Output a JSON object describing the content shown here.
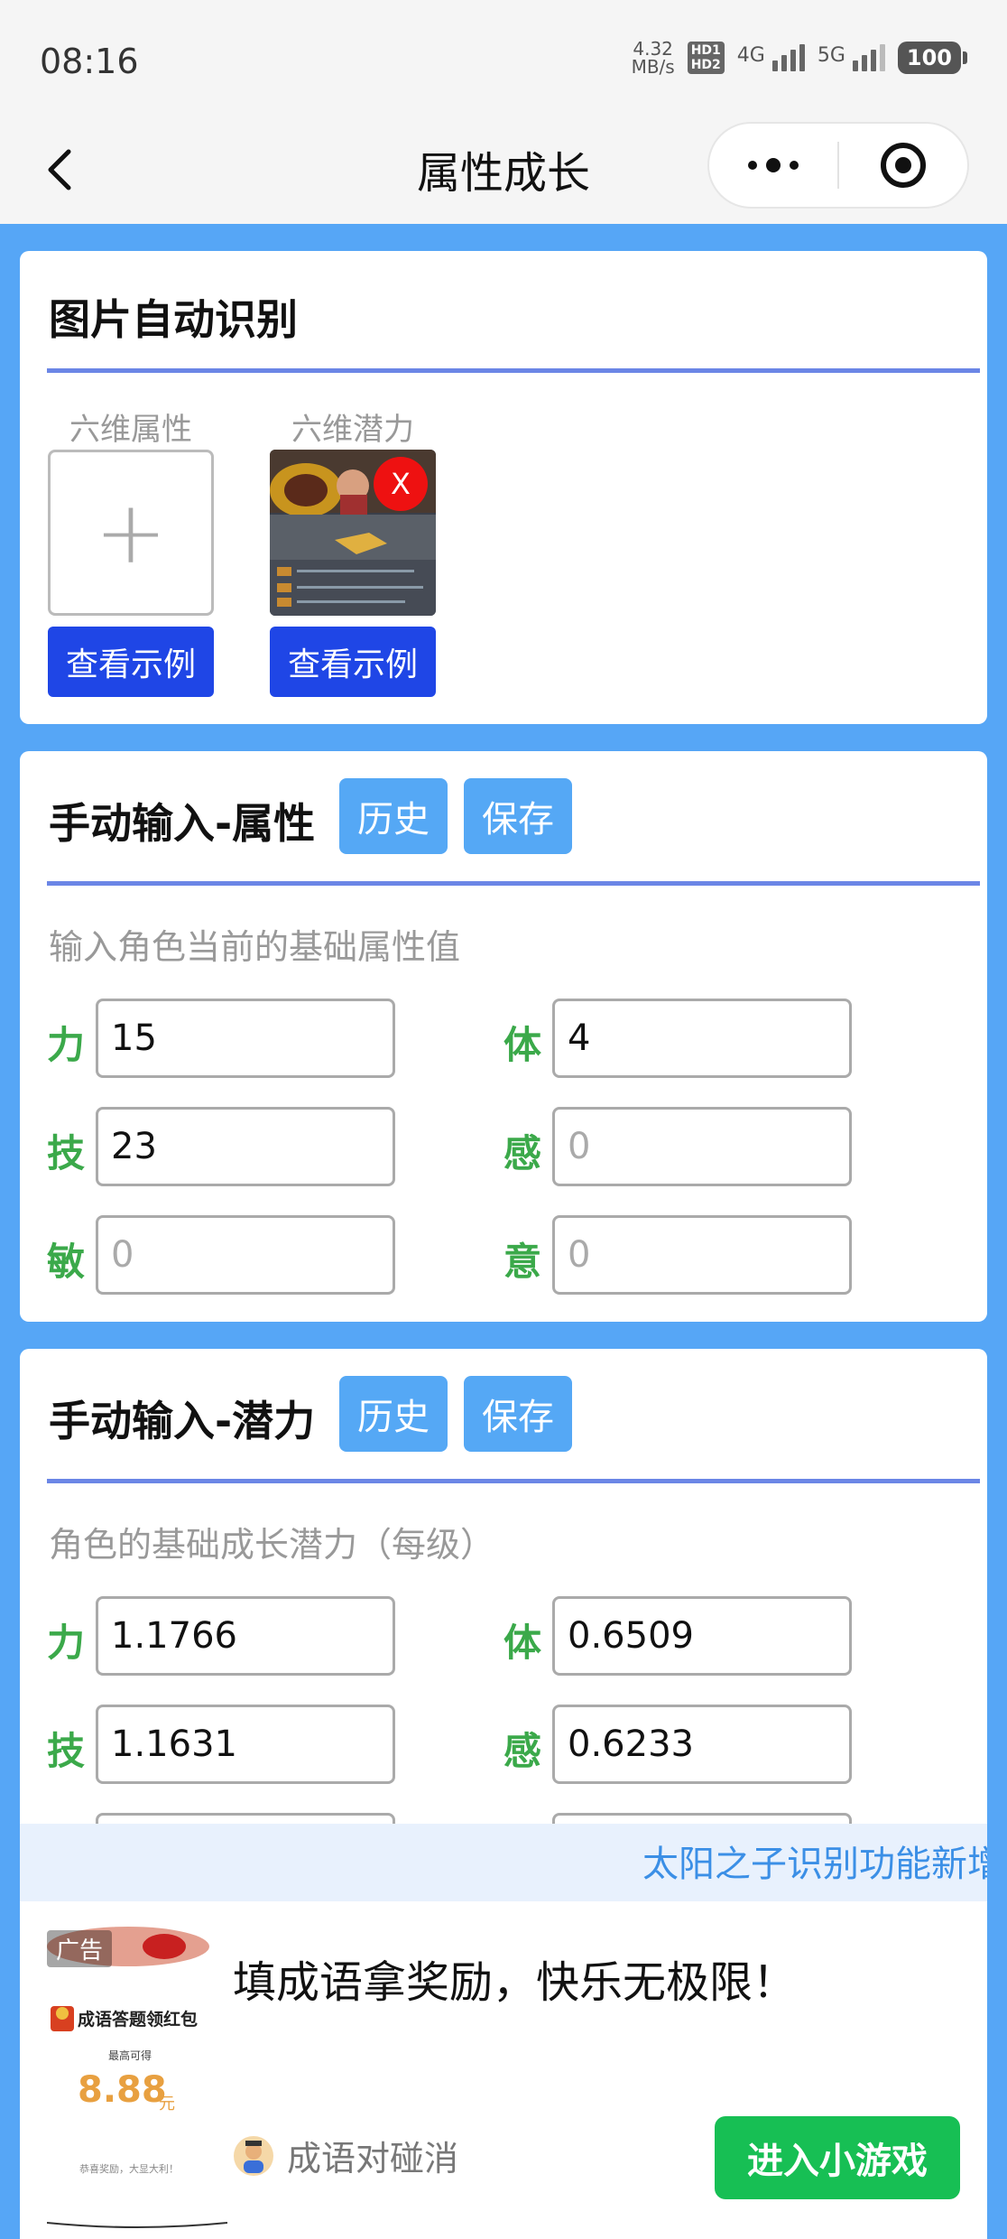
{
  "status_bar": {
    "time": "08:16",
    "net_speed_top": "4.32",
    "net_speed_bottom": "MB/s",
    "hd1": "HD1",
    "hd2": "HD2",
    "sim1_label": "4G",
    "sim2_label": "5G",
    "battery": "100"
  },
  "nav": {
    "title": "属性成长"
  },
  "image_recognition": {
    "title": "图片自动识别",
    "slot_attr_label": "六维属性",
    "slot_potential_label": "六维潜力",
    "example_button": "查看示例",
    "delete_label": "X"
  },
  "manual_attr": {
    "title": "手动输入-属性",
    "history": "历史",
    "save": "保存",
    "hint": "输入角色当前的基础属性值",
    "fields": [
      {
        "label": "力",
        "value": "15"
      },
      {
        "label": "体",
        "value": "4"
      },
      {
        "label": "技",
        "value": "23"
      },
      {
        "label": "感",
        "value": "0"
      },
      {
        "label": "敏",
        "value": "0"
      },
      {
        "label": "意",
        "value": "0"
      }
    ]
  },
  "manual_potential": {
    "title": "手动输入-潜力",
    "history": "历史",
    "save": "保存",
    "hint": "角色的基础成长潜力（每级）",
    "fields": [
      {
        "label": "力",
        "value": "1.1766"
      },
      {
        "label": "体",
        "value": "0.6509"
      },
      {
        "label": "技",
        "value": "1.1631"
      },
      {
        "label": "感",
        "value": "0.6233"
      }
    ]
  },
  "ad": {
    "marquee": "太阳之子识别功能新增",
    "tag": "广告",
    "headline": "填成语拿奖励，快乐无极限！",
    "app_name": "成语对碰消",
    "cta": "进入小游戏",
    "img_title": "成语答题领红包",
    "img_sub": "最高可得",
    "img_amount": "8.88",
    "img_unit": "元",
    "img_foot": "恭喜奖励，大显大利！"
  },
  "colors": {
    "page_bg": "#56a6f6",
    "accent_line": "#6b86e6",
    "example_button": "#1f46e6",
    "chip_button": "#55a8f5",
    "field_label": "#3ba94a",
    "cta": "#17bf54"
  }
}
